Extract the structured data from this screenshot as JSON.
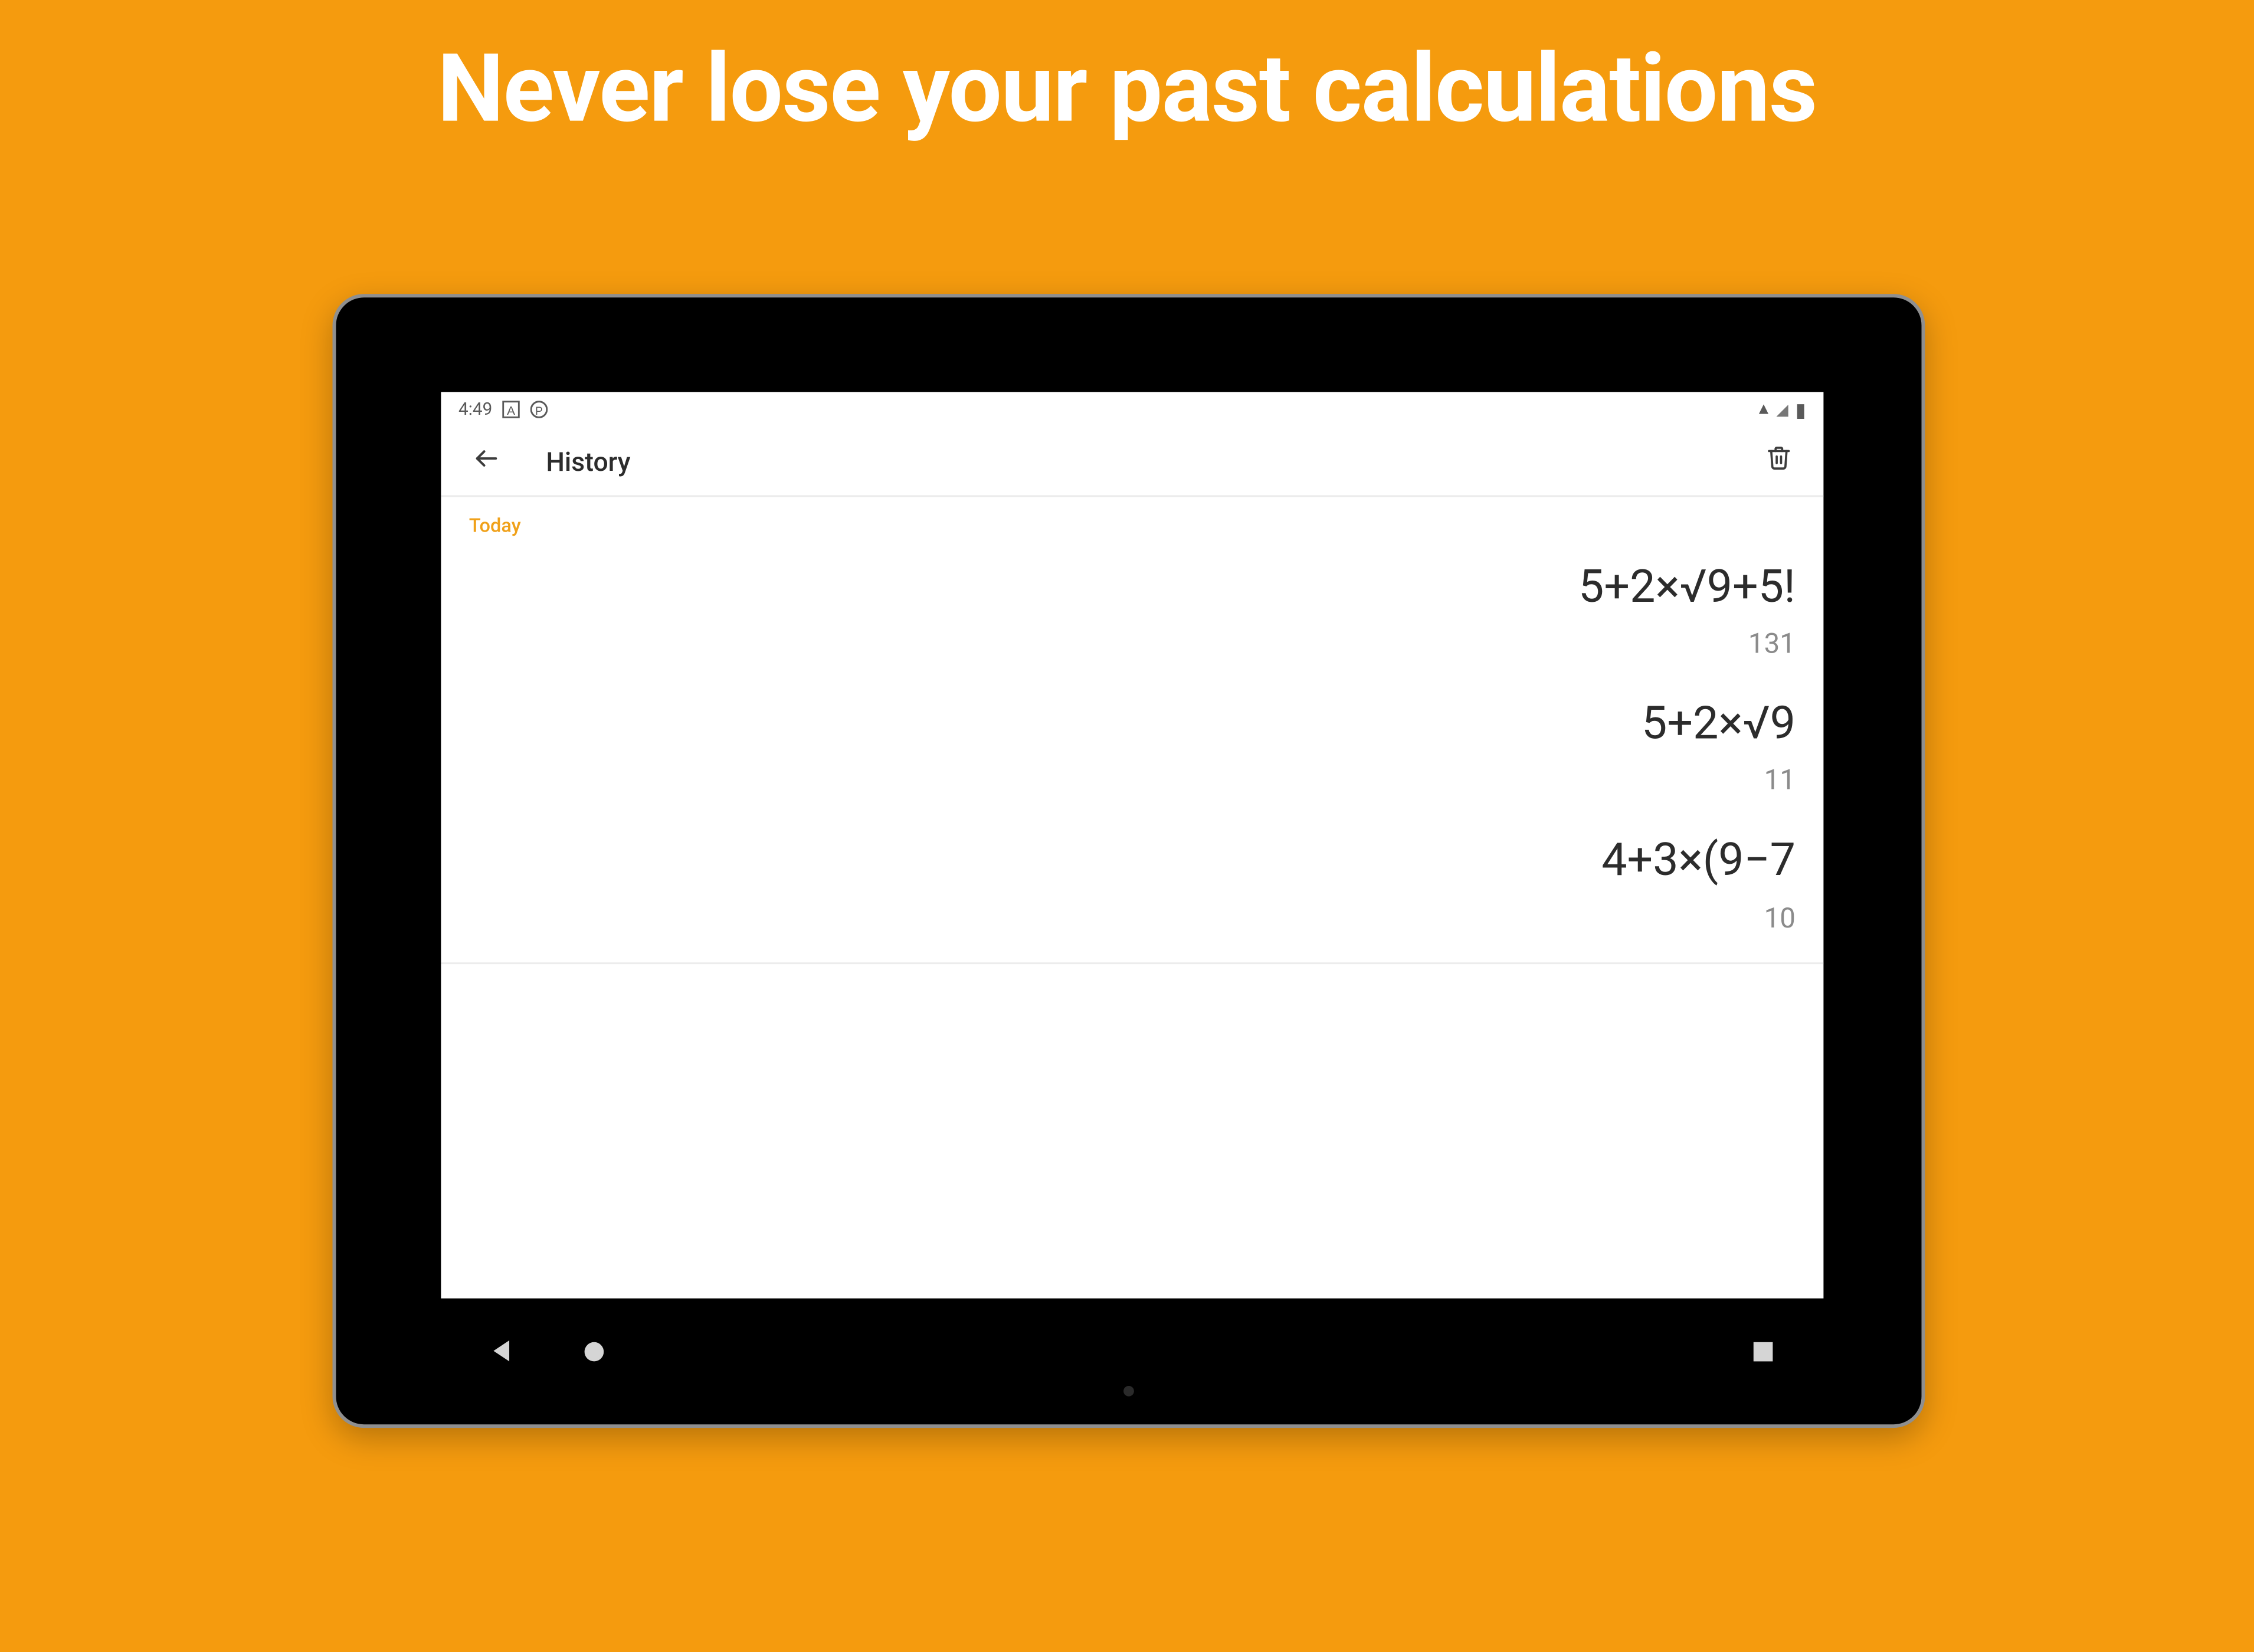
{
  "promo": {
    "headline": "Never lose your past calculations",
    "bg_color": "#f59b0e"
  },
  "status_bar": {
    "time": "4:49",
    "icons_left": [
      "square-a-icon",
      "circle-p-icon"
    ],
    "icons_right": [
      "wifi-icon",
      "signal-icon",
      "battery-icon"
    ]
  },
  "app_bar": {
    "title": "History",
    "back_icon": "arrow-left-icon",
    "action_icon": "trash-icon"
  },
  "history": {
    "section_label": "Today",
    "entries": [
      {
        "expression": "5+2×√9+5!",
        "result": "131"
      },
      {
        "expression": "5+2×√9",
        "result": "11"
      },
      {
        "expression": "4+3×(9−7",
        "result": "10"
      }
    ]
  },
  "nav_bar": {
    "back": "nav-back-icon",
    "home": "nav-home-icon",
    "recent": "nav-recent-icon"
  }
}
